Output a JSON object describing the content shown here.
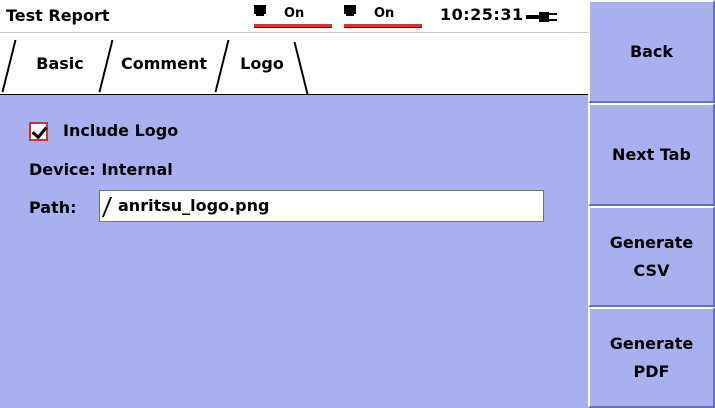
{
  "statusbar": {
    "title": "Test Report",
    "port1_value": "On",
    "port2_value": "On",
    "time": "10:25:31"
  },
  "tabs": [
    {
      "label": "Basic",
      "active": false
    },
    {
      "label": "Comment",
      "active": false
    },
    {
      "label": "Logo",
      "active": true
    }
  ],
  "logo": {
    "include_label": "Include Logo",
    "include_checked": true,
    "device_label": "Device: Internal",
    "path_label": "Path:",
    "path_value": "anritsu_logo.png"
  },
  "softkeys": [
    {
      "label": "Back"
    },
    {
      "label": "Next Tab"
    },
    {
      "label": "Generate\nCSV"
    },
    {
      "label": "Generate\nPDF"
    }
  ],
  "colors": {
    "background": "#a8b0f0",
    "port_indicator": "#e03030",
    "checkbox_border": "#d03030"
  }
}
